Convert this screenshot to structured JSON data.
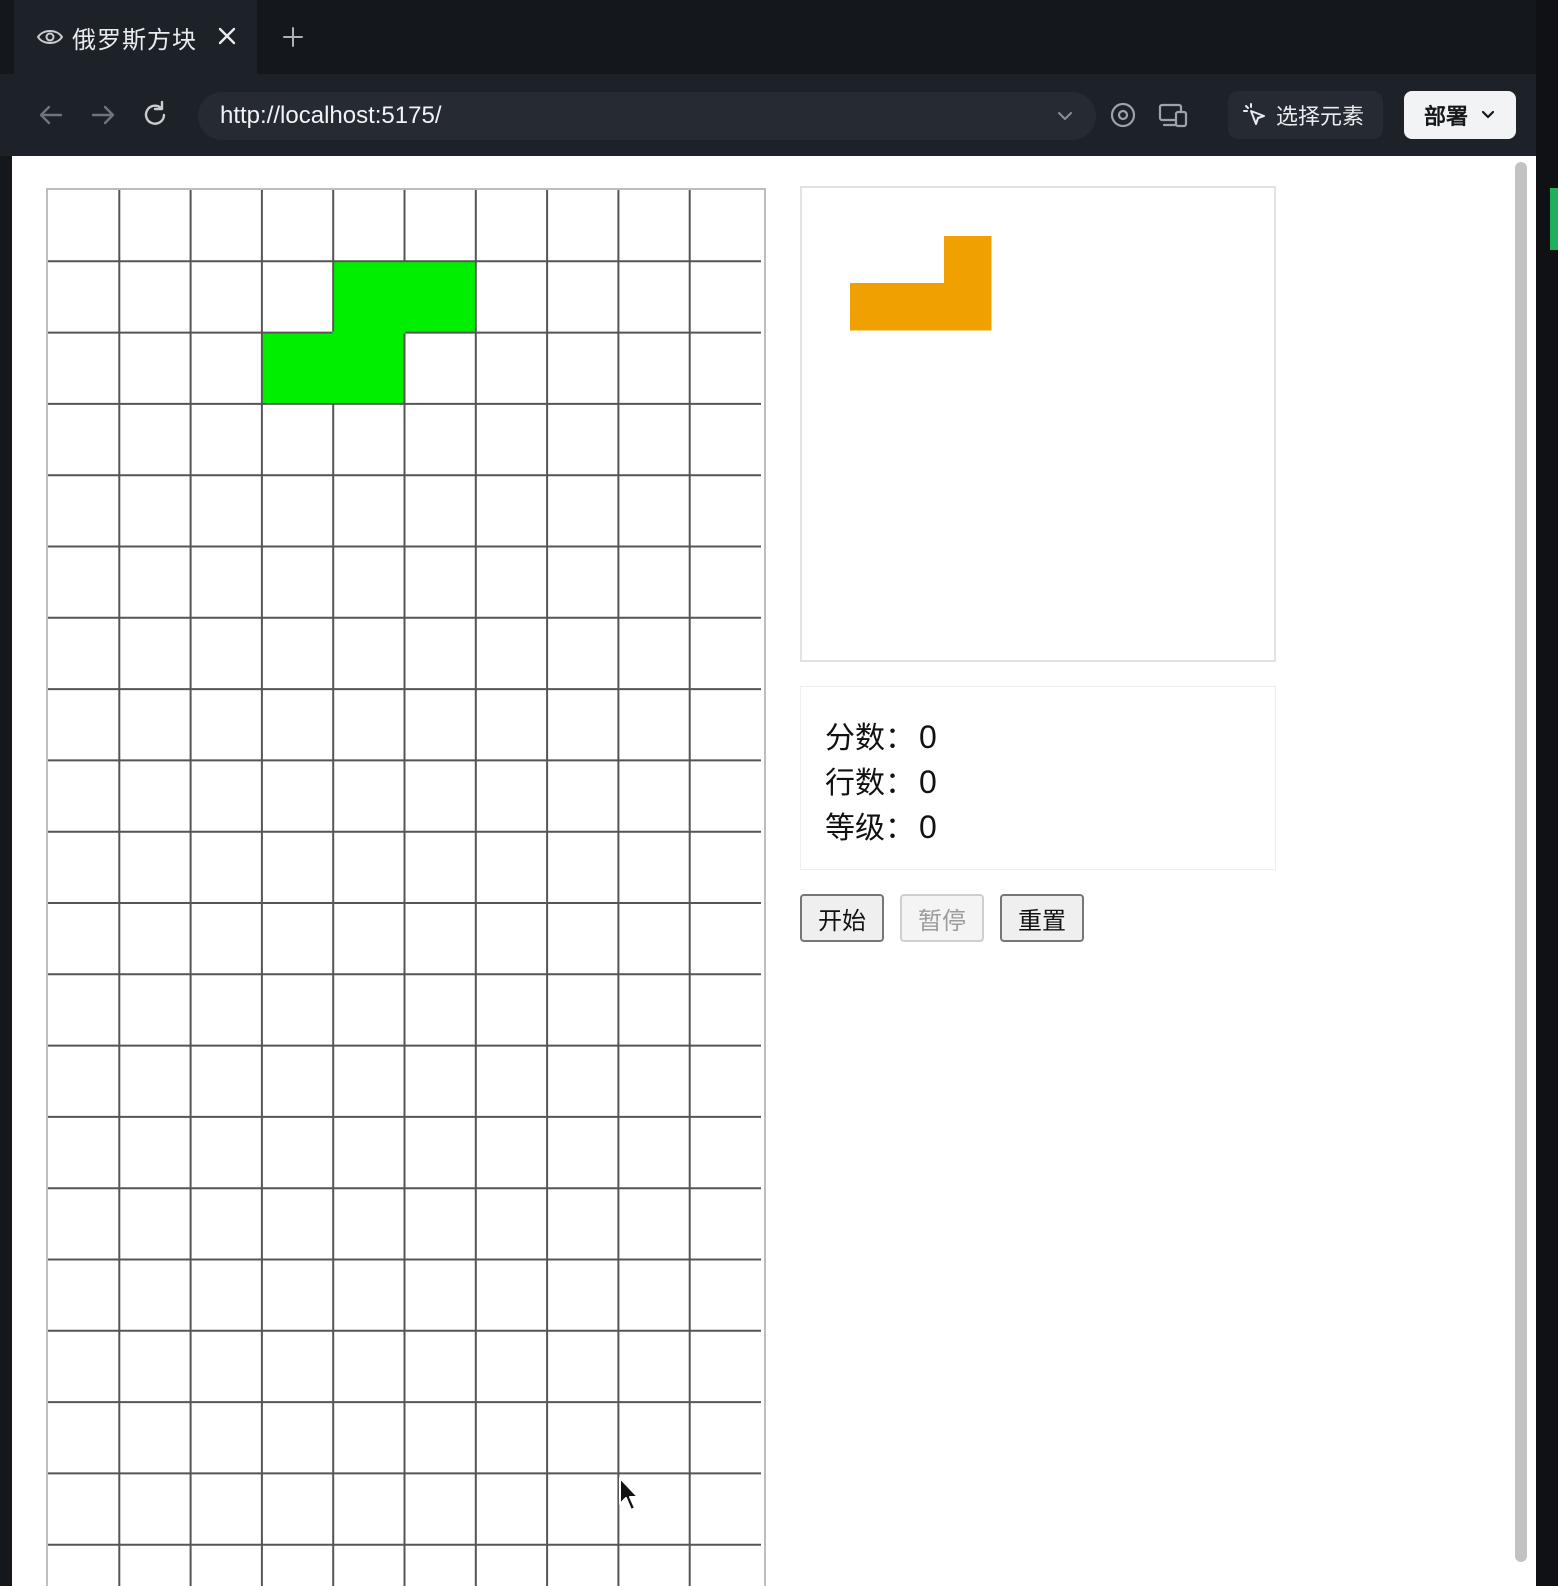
{
  "tab": {
    "title": "俄罗斯方块",
    "icon": "eye-icon"
  },
  "address_bar": {
    "url": "http://localhost:5175/"
  },
  "toolbar": {
    "select_element_label": "选择元素",
    "deploy_label": "部署"
  },
  "board": {
    "columns": 10,
    "visible_rows": 20,
    "line_color": "#555555",
    "active_piece": {
      "shape": "S",
      "color": "#00ee00",
      "cells": [
        [
          4,
          1
        ],
        [
          5,
          1
        ],
        [
          3,
          2
        ],
        [
          4,
          2
        ]
      ]
    }
  },
  "next_piece": {
    "shape": "L",
    "color": "#f0a000",
    "cells": [
      [
        2,
        0
      ],
      [
        0,
        1
      ],
      [
        1,
        1
      ],
      [
        2,
        1
      ]
    ]
  },
  "stats": {
    "score_label": "分数：",
    "score_value": "0",
    "lines_label": "行数：",
    "lines_value": "0",
    "level_label": "等级：",
    "level_value": "0"
  },
  "buttons": {
    "start_label": "开始",
    "pause_label": "暂停",
    "reset_label": "重置"
  }
}
